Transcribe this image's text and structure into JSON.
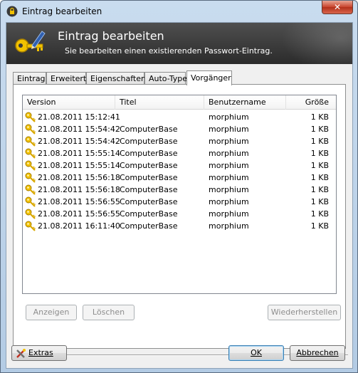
{
  "window": {
    "title": "Eintrag bearbeiten",
    "close_label": "✕"
  },
  "banner": {
    "title": "Eintrag bearbeiten",
    "subtitle": "Sie bearbeiten einen existierenden Passwort-Eintrag."
  },
  "tabs": [
    {
      "label": "Eintrag",
      "active": false
    },
    {
      "label": "Erweitert",
      "active": false
    },
    {
      "label": "Eigenschaften",
      "active": false
    },
    {
      "label": "Auto-Type",
      "active": false
    },
    {
      "label": "Vorgänger",
      "active": true
    }
  ],
  "history": {
    "columns": [
      "Version",
      "Titel",
      "Benutzername",
      "Größe"
    ],
    "rows": [
      {
        "version": "21.08.2011 15:12:41",
        "title": "",
        "user": "morphium",
        "size": "1 KB"
      },
      {
        "version": "21.08.2011 15:54:42",
        "title": "ComputerBase",
        "user": "morphium",
        "size": "1 KB"
      },
      {
        "version": "21.08.2011 15:54:42",
        "title": "ComputerBase",
        "user": "morphium",
        "size": "1 KB"
      },
      {
        "version": "21.08.2011 15:55:14",
        "title": "ComputerBase",
        "user": "morphium",
        "size": "1 KB"
      },
      {
        "version": "21.08.2011 15:55:14",
        "title": "ComputerBase",
        "user": "morphium",
        "size": "1 KB"
      },
      {
        "version": "21.08.2011 15:56:18",
        "title": "ComputerBase",
        "user": "morphium",
        "size": "1 KB"
      },
      {
        "version": "21.08.2011 15:56:18",
        "title": "ComputerBase",
        "user": "morphium",
        "size": "1 KB"
      },
      {
        "version": "21.08.2011 15:56:55",
        "title": "ComputerBase",
        "user": "morphium",
        "size": "1 KB"
      },
      {
        "version": "21.08.2011 15:56:55",
        "title": "ComputerBase",
        "user": "morphium",
        "size": "1 KB"
      },
      {
        "version": "21.08.2011 16:11:40",
        "title": "ComputerBase",
        "user": "morphium",
        "size": "1 KB"
      }
    ]
  },
  "panel_buttons": {
    "view": "Anzeigen",
    "delete": "Löschen",
    "restore": "Wiederherstellen"
  },
  "footer": {
    "tools": "Extras",
    "ok": "OK",
    "cancel": "Abbrechen"
  },
  "icons": {
    "row": "key-icon",
    "banner": "key-pen-icon",
    "title": "lock-icon",
    "tools": "tools-icon"
  },
  "colors": {
    "banner_bg": "#2b2b2b",
    "key_gold": "#e8b400",
    "close_red": "#c8432c"
  }
}
